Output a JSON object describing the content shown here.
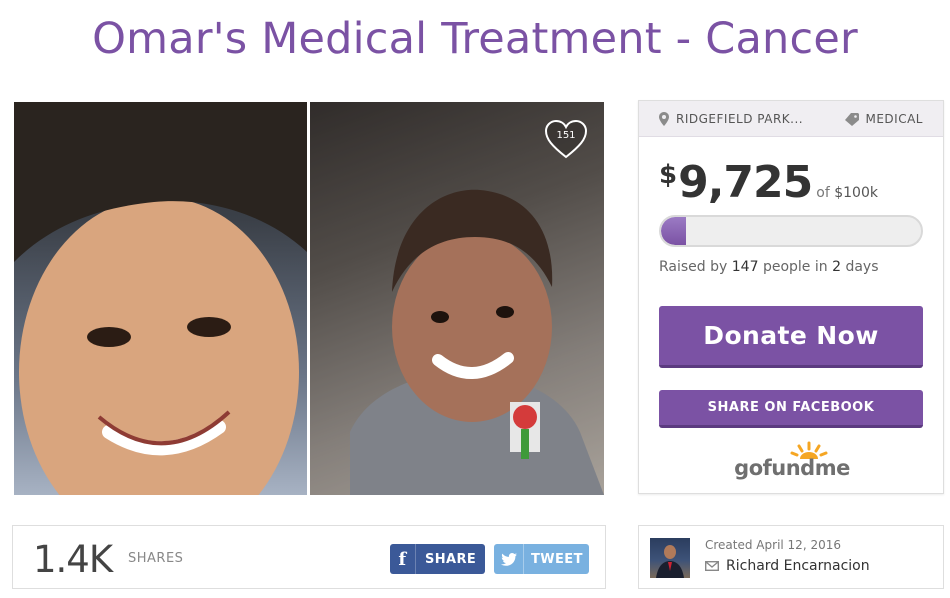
{
  "campaign": {
    "title": "Omar's Medical Treatment - Cancer",
    "photo_left_alt": "young boy portrait",
    "photo_right_alt": "young boy smiling",
    "hearts": "151"
  },
  "card": {
    "location": "RIDGEFIELD PARK...",
    "category": "MEDICAL",
    "currency_symbol": "$",
    "amount": "9,725",
    "goal_prefix": "of",
    "goal": "$100k",
    "progress_fraction": 0.09725,
    "raised_prefix": "Raised by",
    "people": "147",
    "people_suffix": "people in",
    "days": "2",
    "days_suffix": "days",
    "donate_label": "Donate Now",
    "facebook_label": "SHARE ON FACEBOOK",
    "logo_text": "gofundme"
  },
  "shares": {
    "count": "1.4K",
    "label": "SHARES",
    "fb_label": "SHARE",
    "tweet_label": "TWEET"
  },
  "creator": {
    "created": "Created April 12, 2016",
    "name": "Richard Encarnacion"
  },
  "colors": {
    "brand_purple": "#7b52a4",
    "facebook_blue": "#3b5998",
    "twitter_blue": "#79b1e0",
    "logo_orange": "#f5a623"
  },
  "icons": [
    "heart-icon",
    "map-pin-icon",
    "tag-icon",
    "facebook-icon",
    "twitter-bird-icon",
    "mail-icon"
  ]
}
